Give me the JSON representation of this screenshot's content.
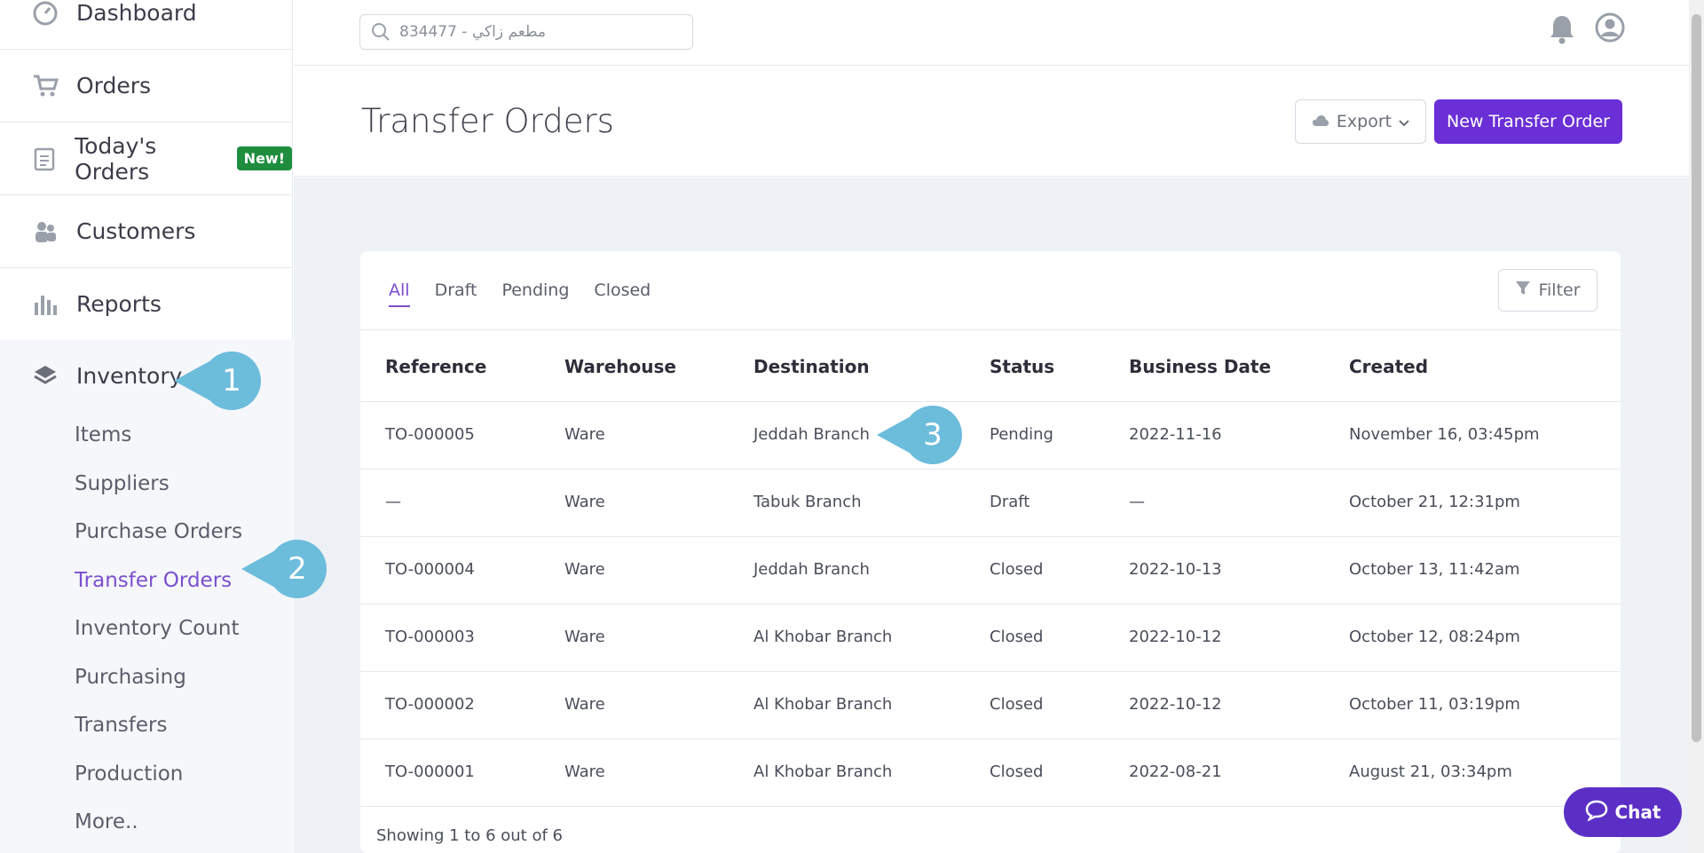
{
  "sidebar": {
    "items": [
      {
        "label": "Dashboard",
        "icon": "gauge-icon"
      },
      {
        "label": "Orders",
        "icon": "cart-icon"
      },
      {
        "label": "Today's Orders",
        "icon": "clipboard-icon",
        "badge": "New!"
      },
      {
        "label": "Customers",
        "icon": "users-icon"
      },
      {
        "label": "Reports",
        "icon": "bar-chart-icon"
      }
    ],
    "inventory": {
      "label": "Inventory",
      "icon": "layers-icon",
      "items": [
        "Items",
        "Suppliers",
        "Purchase Orders",
        "Transfer Orders",
        "Inventory Count",
        "Purchasing",
        "Transfers",
        "Production",
        "More.."
      ],
      "active": "Transfer Orders"
    }
  },
  "callouts": [
    "1",
    "2",
    "3"
  ],
  "topbar": {
    "search_placeholder": "مطعم زاكي - 834477"
  },
  "header": {
    "title": "Transfer Orders",
    "export_label": "Export",
    "new_label": "New Transfer Order"
  },
  "tabs": [
    "All",
    "Draft",
    "Pending",
    "Closed"
  ],
  "filter_label": "Filter",
  "table": {
    "columns": [
      "Reference",
      "Warehouse",
      "Destination",
      "Status",
      "Business Date",
      "Created"
    ],
    "rows": [
      [
        "TO-000005",
        "Ware",
        "Jeddah Branch",
        "Pending",
        "2022-11-16",
        "November 16, 03:45pm"
      ],
      [
        "—",
        "Ware",
        "Tabuk Branch",
        "Draft",
        "—",
        "October 21, 12:31pm"
      ],
      [
        "TO-000004",
        "Ware",
        "Jeddah Branch",
        "Closed",
        "2022-10-13",
        "October 13, 11:42am"
      ],
      [
        "TO-000003",
        "Ware",
        "Al Khobar Branch",
        "Closed",
        "2022-10-12",
        "October 12, 08:24pm"
      ],
      [
        "TO-000002",
        "Ware",
        "Al Khobar Branch",
        "Closed",
        "2022-10-12",
        "October 11, 03:19pm"
      ],
      [
        "TO-000001",
        "Ware",
        "Al Khobar Branch",
        "Closed",
        "2022-08-21",
        "August 21, 03:34pm"
      ]
    ],
    "footer": "Showing 1 to 6 out of 6"
  },
  "chat_label": "Chat",
  "colors": {
    "accent": "#6a2fd6",
    "callout": "#6cbcdc",
    "badge": "#1e8e3e"
  }
}
